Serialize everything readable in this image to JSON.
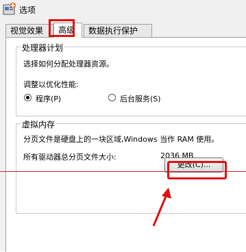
{
  "window": {
    "title": "选项"
  },
  "tabs": [
    {
      "label": "视觉效果"
    },
    {
      "label": "高级"
    },
    {
      "label": "数据执行保护"
    }
  ],
  "cpu_group": {
    "title": "处理器计划",
    "description": "选择如何分配处理器资源。",
    "adjust_label": "调整以优化性能:",
    "option_programs": "程序(P)",
    "option_services": "后台服务(S)",
    "selected": "程序(P)"
  },
  "vm_group": {
    "title": "虚拟内存",
    "description": "分页文件是硬盘上的一块区域,Windows 当作 RAM 使用。",
    "total_label": "所有驱动器总分页文件大小:",
    "total_value": "2036 MB",
    "change_button": "更改(C)..."
  },
  "colors": {
    "highlight": "#e01010"
  }
}
